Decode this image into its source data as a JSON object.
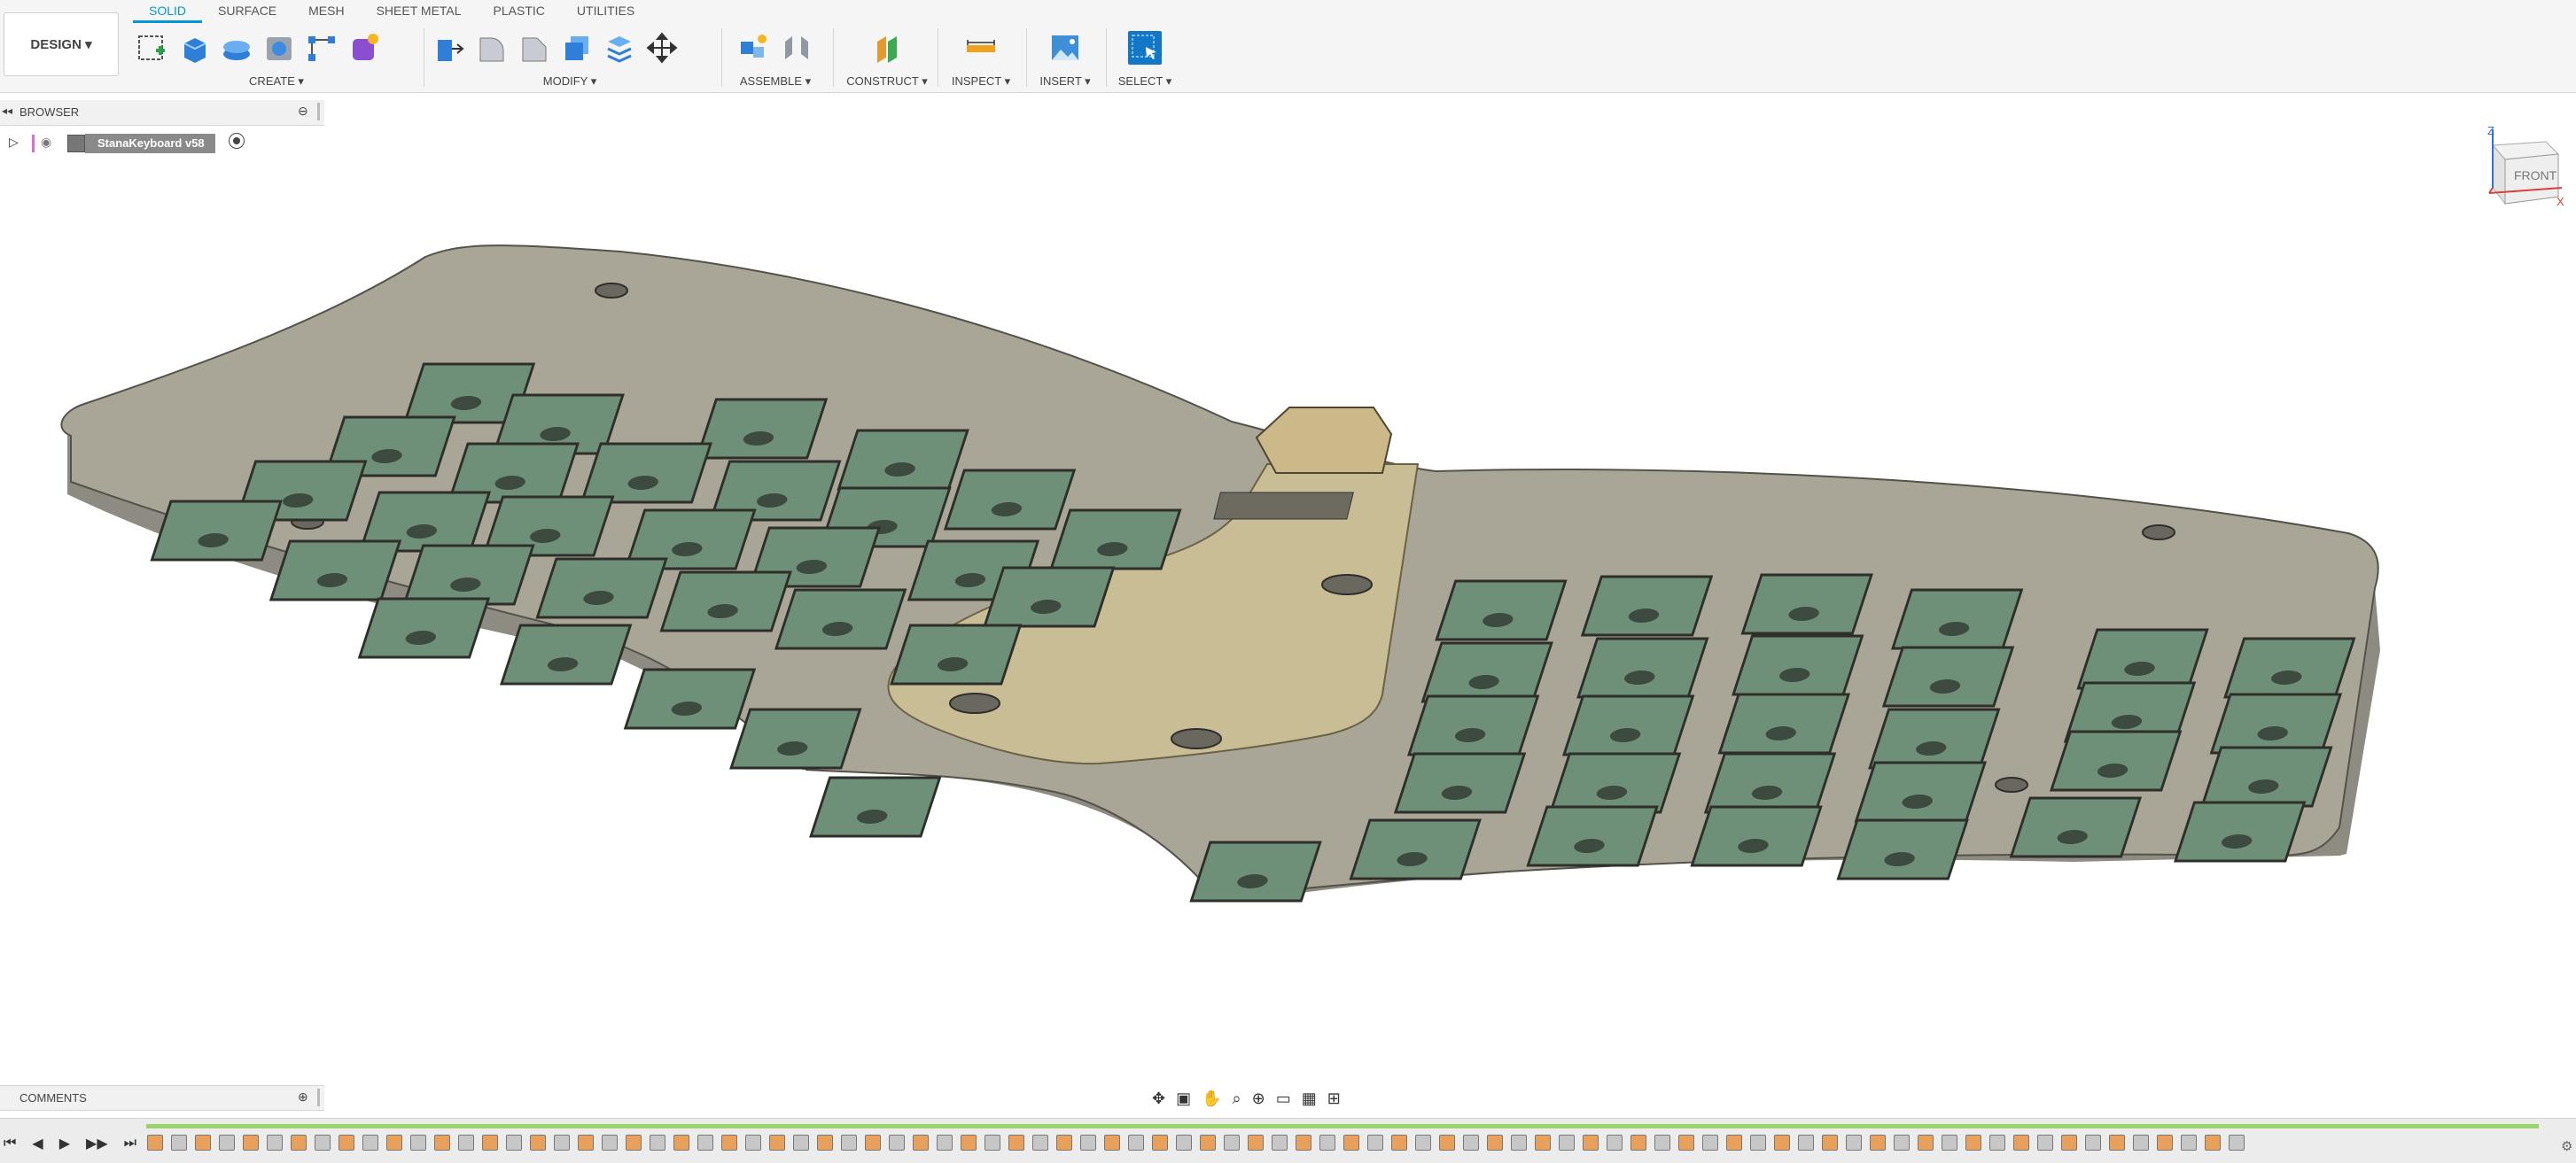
{
  "workspace": {
    "label": "DESIGN ▾"
  },
  "tabs": [
    "SOLID",
    "SURFACE",
    "MESH",
    "SHEET METAL",
    "PLASTIC",
    "UTILITIES"
  ],
  "active_tab": "SOLID",
  "groups": {
    "create": "CREATE ▾",
    "modify": "MODIFY ▾",
    "assemble": "ASSEMBLE ▾",
    "construct": "CONSTRUCT ▾",
    "inspect": "INSPECT ▾",
    "insert": "INSERT ▾",
    "select": "SELECT ▾"
  },
  "browser": {
    "title": "BROWSER",
    "document_name": "StanaKeyboard v58"
  },
  "comments": {
    "title": "COMMENTS"
  },
  "viewcube": {
    "face": "FRONT",
    "axis_x": "X",
    "axis_z": "Z"
  },
  "colors": {
    "accent": "#0696d7",
    "plate": "#9d9a8f",
    "plate_top": "#a9a698",
    "cover": "#c9bd95",
    "switch": "#6e9078"
  }
}
